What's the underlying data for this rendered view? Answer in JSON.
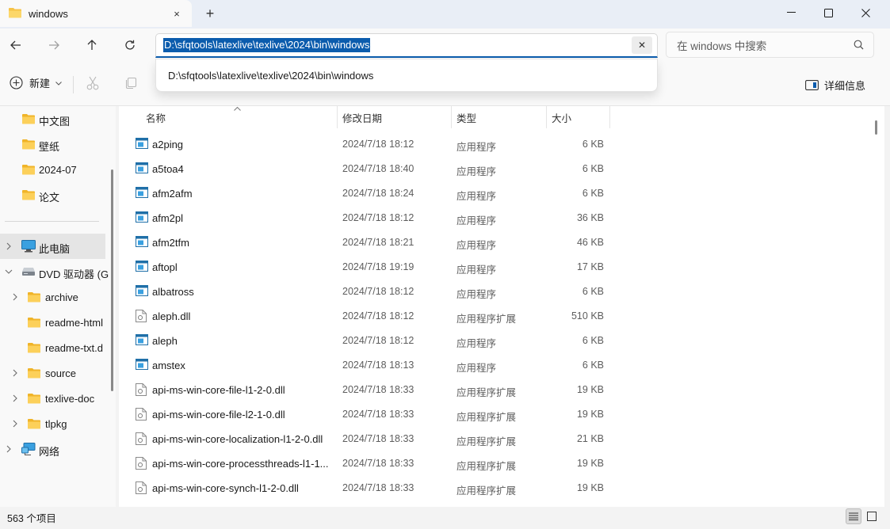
{
  "tab": {
    "title": "windows",
    "close_icon": "×",
    "new_icon": "+"
  },
  "window_controls": {
    "minimize": "—",
    "maximize": "☐",
    "close": "✕"
  },
  "address": {
    "path": "D:\\sfqtools\\latexlive\\texlive\\2024\\bin\\windows",
    "clear_icon": "✕",
    "suggestion": "D:\\sfqtools\\latexlive\\texlive\\2024\\bin\\windows"
  },
  "search": {
    "placeholder": "在 windows 中搜索"
  },
  "toolbar": {
    "new_label": "新建",
    "details_label": "详细信息"
  },
  "sidebar": {
    "quick_access": [
      {
        "label": "中文图"
      },
      {
        "label": "壁纸"
      },
      {
        "label": "2024-07"
      },
      {
        "label": "论文"
      }
    ],
    "this_pc": "此电脑",
    "dvd": "DVD 驱动器 (G",
    "folders": [
      {
        "label": "archive",
        "expandable": true
      },
      {
        "label": "readme-html",
        "expandable": false
      },
      {
        "label": "readme-txt.d",
        "expandable": false
      },
      {
        "label": "source",
        "expandable": true
      },
      {
        "label": "texlive-doc",
        "expandable": true
      },
      {
        "label": "tlpkg",
        "expandable": true
      }
    ],
    "network": "网络"
  },
  "columns": {
    "name": "名称",
    "date": "修改日期",
    "type": "类型",
    "size": "大小"
  },
  "files": [
    {
      "name": "a2ping",
      "date": "2024/7/18 18:12",
      "type": "应用程序",
      "size": "6 KB",
      "kind": "exe"
    },
    {
      "name": "a5toa4",
      "date": "2024/7/18 18:40",
      "type": "应用程序",
      "size": "6 KB",
      "kind": "exe"
    },
    {
      "name": "afm2afm",
      "date": "2024/7/18 18:24",
      "type": "应用程序",
      "size": "6 KB",
      "kind": "exe"
    },
    {
      "name": "afm2pl",
      "date": "2024/7/18 18:12",
      "type": "应用程序",
      "size": "36 KB",
      "kind": "exe"
    },
    {
      "name": "afm2tfm",
      "date": "2024/7/18 18:21",
      "type": "应用程序",
      "size": "46 KB",
      "kind": "exe"
    },
    {
      "name": "aftopl",
      "date": "2024/7/18 19:19",
      "type": "应用程序",
      "size": "17 KB",
      "kind": "exe"
    },
    {
      "name": "albatross",
      "date": "2024/7/18 18:12",
      "type": "应用程序",
      "size": "6 KB",
      "kind": "exe"
    },
    {
      "name": "aleph.dll",
      "date": "2024/7/18 18:12",
      "type": "应用程序扩展",
      "size": "510 KB",
      "kind": "dll"
    },
    {
      "name": "aleph",
      "date": "2024/7/18 18:12",
      "type": "应用程序",
      "size": "6 KB",
      "kind": "exe"
    },
    {
      "name": "amstex",
      "date": "2024/7/18 18:13",
      "type": "应用程序",
      "size": "6 KB",
      "kind": "exe"
    },
    {
      "name": "api-ms-win-core-file-l1-2-0.dll",
      "date": "2024/7/18 18:33",
      "type": "应用程序扩展",
      "size": "19 KB",
      "kind": "dll"
    },
    {
      "name": "api-ms-win-core-file-l2-1-0.dll",
      "date": "2024/7/18 18:33",
      "type": "应用程序扩展",
      "size": "19 KB",
      "kind": "dll"
    },
    {
      "name": "api-ms-win-core-localization-l1-2-0.dll",
      "date": "2024/7/18 18:33",
      "type": "应用程序扩展",
      "size": "21 KB",
      "kind": "dll"
    },
    {
      "name": "api-ms-win-core-processthreads-l1-1...",
      "date": "2024/7/18 18:33",
      "type": "应用程序扩展",
      "size": "19 KB",
      "kind": "dll"
    },
    {
      "name": "api-ms-win-core-synch-l1-2-0.dll",
      "date": "2024/7/18 18:33",
      "type": "应用程序扩展",
      "size": "19 KB",
      "kind": "dll"
    }
  ],
  "status": {
    "count": "563 个项目"
  },
  "colors": {
    "accent": "#0b5cad",
    "folder": "#f6c347",
    "selection": "#e5e5e5"
  }
}
